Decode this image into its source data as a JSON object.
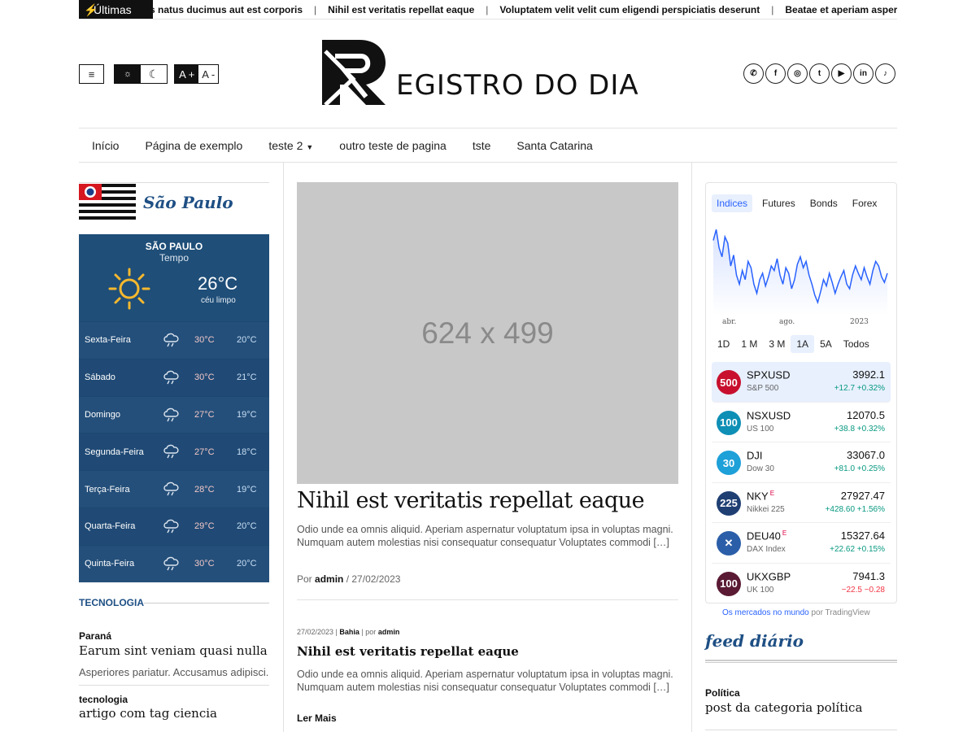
{
  "ticker": {
    "label": "Últimas",
    "items": [
      "s natus ducimus aut est corporis",
      "Nihil est veritatis repellat eaque",
      "Voluptatem velit velit cum eligendi perspiciatis deserunt",
      "Beatae et aperiam aspernatur adipisci"
    ],
    "separator": "|"
  },
  "header": {
    "menu_icon": "≡",
    "theme": {
      "light_icon": "sun-icon",
      "dark_icon": "moon-icon"
    },
    "font": {
      "increase": "A +",
      "decrease": "A -"
    },
    "logo_text": "EGISTRO DO DIA",
    "logo_cap_d": "D",
    "socials": [
      "whatsapp-icon",
      "facebook-icon",
      "instagram-icon",
      "twitter-icon",
      "youtube-icon",
      "linkedin-icon",
      "tiktok-icon"
    ]
  },
  "nav": {
    "items": [
      "Início",
      "Página de exemplo",
      "teste 2",
      "outro teste de pagina",
      "tste",
      "Santa Catarina"
    ],
    "dropdown_caret": "▼"
  },
  "left": {
    "state_name": "São Paulo",
    "weather": {
      "city": "SÃO PAULO",
      "subtitle": "Tempo",
      "current_temp": "26°C",
      "current_desc": "céu limpo",
      "forecast": [
        {
          "day": "Sexta-Feira",
          "hi": "30°C",
          "lo": "20°C"
        },
        {
          "day": "Sábado",
          "hi": "30°C",
          "lo": "21°C"
        },
        {
          "day": "Domingo",
          "hi": "27°C",
          "lo": "19°C"
        },
        {
          "day": "Segunda-Feira",
          "hi": "27°C",
          "lo": "18°C"
        },
        {
          "day": "Terça-Feira",
          "hi": "28°C",
          "lo": "19°C"
        },
        {
          "day": "Quarta-Feira",
          "hi": "29°C",
          "lo": "20°C"
        },
        {
          "day": "Quinta-Feira",
          "hi": "30°C",
          "lo": "20°C"
        }
      ]
    },
    "section_title": "TECNOLOGIA",
    "posts": [
      {
        "category": "Paraná",
        "title": "Earum sint veniam quasi nulla",
        "excerpt": "Asperiores pariatur. Accusamus adipisci."
      },
      {
        "category": "tecnologia",
        "title": "artigo com tag ciencia"
      }
    ]
  },
  "main": {
    "placeholder": "624 x 499",
    "featured": {
      "title": "Nihil est veritatis repellat eaque",
      "excerpt": "Odio unde ea omnis aliquid. Aperiam aspernatur voluptatum ipsa in voluptas magni. Numquam autem molestias nisi consequatur consequatur Voluptates commodi […]",
      "meta_prefix": "Por",
      "author": "admin",
      "date": "/ 27/02/2023"
    },
    "post2": {
      "date": "27/02/2023 |",
      "category": "Bahia",
      "by": "| por",
      "author": "admin",
      "title": "Nihil est veritatis repellat eaque",
      "excerpt": "Odio unde ea omnis aliquid. Aperiam aspernatur voluptatum ipsa in voluptas magni. Numquam autem molestias nisi consequatur consequatur Voluptates commodi […]",
      "read_more": "Ler Mais"
    }
  },
  "market": {
    "tabs": [
      "Indices",
      "Futures",
      "Bonds",
      "Forex"
    ],
    "active_tab": "Indices",
    "axis_labels": [
      "abr.",
      "ago.",
      "2023"
    ],
    "ranges": [
      "1D",
      "1 M",
      "3 M",
      "1A",
      "5A",
      "Todos"
    ],
    "active_range": "1A",
    "rows": [
      {
        "badge": "500",
        "badge_color": "#c8102e",
        "symbol": "SPXUSD",
        "sup": "",
        "name": "S&P 500",
        "value": "3992.1",
        "change": "+12.7 +0.32%",
        "neg": false
      },
      {
        "badge": "100",
        "badge_color": "#0e8fb5",
        "symbol": "NSXUSD",
        "sup": "",
        "name": "US 100",
        "value": "12070.5",
        "change": "+38.8 +0.32%",
        "neg": false
      },
      {
        "badge": "30",
        "badge_color": "#1ea0d8",
        "symbol": "DJI",
        "sup": "",
        "name": "Dow 30",
        "value": "33067.0",
        "change": "+81.0 +0.25%",
        "neg": false
      },
      {
        "badge": "225",
        "badge_color": "#1f3f73",
        "symbol": "NKY",
        "sup": "E",
        "name": "Nikkei 225",
        "value": "27927.47",
        "change": "+428.60 +1.56%",
        "neg": false
      },
      {
        "badge": "✕",
        "badge_color": "#2b5ea8",
        "symbol": "DEU40",
        "sup": "E",
        "name": "DAX Index",
        "value": "15327.64",
        "change": "+22.62 +0.15%",
        "neg": false
      },
      {
        "badge": "100",
        "badge_color": "#5a1a33",
        "symbol": "UKXGBP",
        "sup": "",
        "name": "UK 100",
        "value": "7941.3",
        "change": "−22.5 −0.28",
        "neg": true
      }
    ],
    "footer_link": "Os mercados no mundo",
    "footer_by": "por TradingView",
    "colors": {
      "line": "#2962ff",
      "accent": "#1e4f84"
    },
    "series": [
      0.78,
      0.9,
      0.7,
      0.6,
      0.82,
      0.75,
      0.5,
      0.62,
      0.4,
      0.3,
      0.45,
      0.35,
      0.55,
      0.48,
      0.3,
      0.2,
      0.35,
      0.42,
      0.28,
      0.38,
      0.5,
      0.45,
      0.58,
      0.4,
      0.3,
      0.48,
      0.42,
      0.25,
      0.35,
      0.52,
      0.6,
      0.48,
      0.55,
      0.4,
      0.3,
      0.18,
      0.1,
      0.22,
      0.35,
      0.28,
      0.42,
      0.32,
      0.2,
      0.3,
      0.38,
      0.45,
      0.3,
      0.25,
      0.4,
      0.5,
      0.42,
      0.35,
      0.48,
      0.38,
      0.3,
      0.45,
      0.55,
      0.5,
      0.38,
      0.32,
      0.42
    ]
  },
  "feed": {
    "title": "feed diário",
    "category": "Política",
    "post_title": "post da categoria política"
  }
}
